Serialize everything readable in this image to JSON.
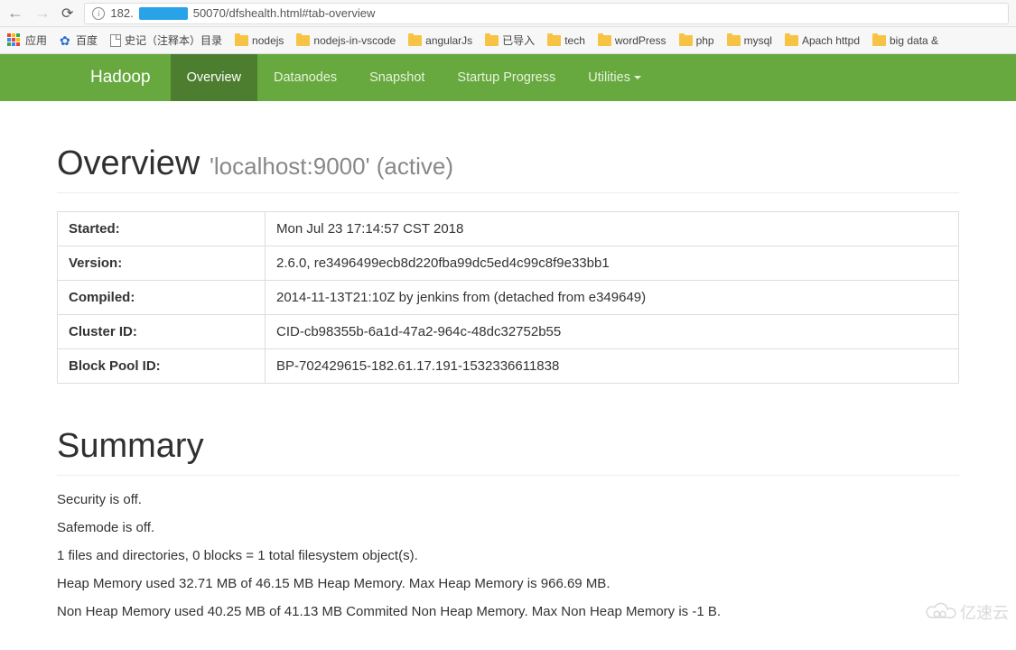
{
  "browser": {
    "url_prefix": "182.",
    "url_suffix": "50070/dfshealth.html#tab-overview"
  },
  "bookmarks": {
    "apps_label": "应用",
    "baidu": "百度",
    "history": "史记（注释本）目录",
    "items": [
      "nodejs",
      "nodejs-in-vscode",
      "angularJs",
      "已导入",
      "tech",
      "wordPress",
      "php",
      "mysql",
      "Apach httpd",
      "big data &"
    ]
  },
  "navbar": {
    "brand": "Hadoop",
    "tabs": {
      "overview": "Overview",
      "datanodes": "Datanodes",
      "snapshot": "Snapshot",
      "startup": "Startup Progress",
      "utilities": "Utilities"
    }
  },
  "overview": {
    "heading": "Overview",
    "host": "'localhost:9000' (active)"
  },
  "info_table": {
    "started": {
      "label": "Started:",
      "value": "Mon Jul 23 17:14:57 CST 2018"
    },
    "version": {
      "label": "Version:",
      "value": "2.6.0, re3496499ecb8d220fba99dc5ed4c99c8f9e33bb1"
    },
    "compiled": {
      "label": "Compiled:",
      "value": "2014-11-13T21:10Z by jenkins from (detached from e349649)"
    },
    "cluster_id": {
      "label": "Cluster ID:",
      "value": "CID-cb98355b-6a1d-47a2-964c-48dc32752b55"
    },
    "block_pool_id": {
      "label": "Block Pool ID:",
      "value": "BP-702429615-182.61.17.191-1532336611838"
    }
  },
  "summary": {
    "heading": "Summary",
    "lines": [
      "Security is off.",
      "Safemode is off.",
      "1 files and directories, 0 blocks = 1 total filesystem object(s).",
      "Heap Memory used 32.71 MB of 46.15 MB Heap Memory. Max Heap Memory is 966.69 MB.",
      "Non Heap Memory used 40.25 MB of 41.13 MB Commited Non Heap Memory. Max Non Heap Memory is -1 B."
    ]
  },
  "watermark": "亿速云"
}
